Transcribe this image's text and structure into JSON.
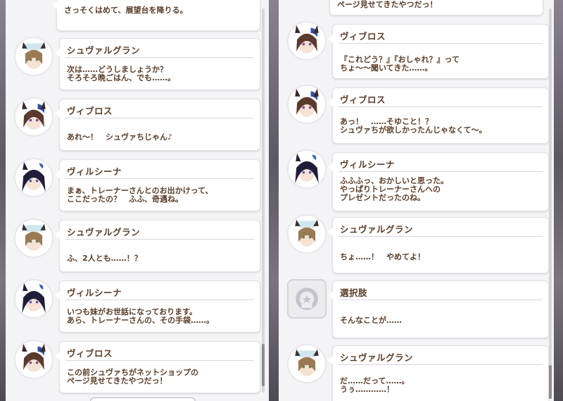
{
  "left_panel": {
    "messages": [
      {
        "speaker": "",
        "avatar": "none",
        "text": "さっそくはめて、展望台を降りる。"
      },
      {
        "speaker": "シュヴァルグラン",
        "avatar": "schwarz-avatar",
        "text": "次は……どうしましょうか？\nそろそろ晩ごはん、でも……。"
      },
      {
        "speaker": "ヴィブロス",
        "avatar": "vivlos-avatar",
        "text": "あれ～！　シュヴァちじゃん♪"
      },
      {
        "speaker": "ヴィルシーナ",
        "avatar": "verxina-avatar",
        "text": "まぁ、トレーナーさんとのお出かけって、\nここだったの？　ふふ、奇遇ね。"
      },
      {
        "speaker": "シュヴァルグラン",
        "avatar": "schwarz-avatar",
        "text": "ふ、2人とも……！？"
      },
      {
        "speaker": "ヴィルシーナ",
        "avatar": "verxina-avatar",
        "text": "いつも妹がお世話になっております。\nあら、トレーナーさんの、その手袋……。"
      },
      {
        "speaker": "ヴィブロス",
        "avatar": "vivlos-avatar",
        "text": "この前シュヴァちがネットショップの\nページ見せてきたやつだっ！"
      }
    ]
  },
  "right_panel": {
    "messages": [
      {
        "speaker": "",
        "avatar": "none",
        "text": "ページ見せてきたやつだっ！"
      },
      {
        "speaker": "ヴィブロス",
        "avatar": "vivlos-avatar",
        "text": "『これどう？』『おしゃれ？』って\nちょ～～聞いてきた……。"
      },
      {
        "speaker": "ヴィブロス",
        "avatar": "vivlos-avatar",
        "text": "あっ！　……そゆこと！？\nシュヴァちが欲しかったんじゃなくて～。"
      },
      {
        "speaker": "ヴィルシーナ",
        "avatar": "verxina-avatar",
        "text": "ふふふっ、おかしいと思った。\nやっぱりトレーナーさんへの\nプレゼントだったのね。"
      },
      {
        "speaker": "シュヴァルグラン",
        "avatar": "schwarz-avatar",
        "text": "ちょ……！　やめてよ！"
      },
      {
        "speaker": "選択肢",
        "avatar": "choice-icon",
        "text": "そんなことが……"
      },
      {
        "speaker": "シュヴァルグラン",
        "avatar": "schwarz-avatar",
        "text": "だ……だって……。\nうぅ…………！"
      }
    ]
  },
  "colors": {
    "text_brown": "#5a3d28",
    "bubble_bg": "#ffffff",
    "panel_bg": "#f4f3f5"
  }
}
